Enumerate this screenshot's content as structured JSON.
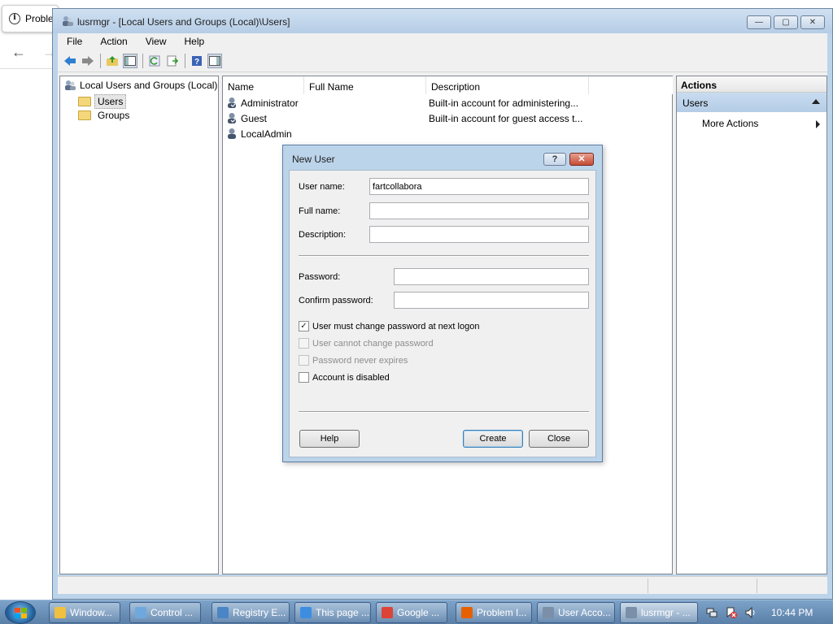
{
  "browser_bg": {
    "tab_label": "Proble"
  },
  "window": {
    "title": "lusrmgr - [Local Users and Groups (Local)\\Users]",
    "min": "—",
    "max": "▢",
    "close": "✕"
  },
  "menu": [
    "File",
    "Action",
    "View",
    "Help"
  ],
  "tree": {
    "root": "Local Users and Groups (Local)",
    "users": "Users",
    "groups": "Groups"
  },
  "list": {
    "columns": [
      "Name",
      "Full Name",
      "Description"
    ],
    "rows": [
      {
        "name": "Administrator",
        "full_name": "",
        "description": "Built-in account for administering..."
      },
      {
        "name": "Guest",
        "full_name": "",
        "description": "Built-in account for guest access t..."
      },
      {
        "name": "LocalAdmin",
        "full_name": "",
        "description": ""
      }
    ]
  },
  "actions": {
    "title": "Actions",
    "section": "Users",
    "more": "More Actions"
  },
  "dialog": {
    "title": "New User",
    "help_glyph": "?",
    "close_glyph": "✕",
    "user_name_label": "User name:",
    "user_name_value": "fartcollabora",
    "full_name_label": "Full name:",
    "full_name_value": "",
    "description_label": "Description:",
    "description_value": "",
    "password_label": "Password:",
    "confirm_label": "Confirm password:",
    "checkboxes": [
      {
        "label": "User must change password at next logon",
        "checked": true,
        "enabled": true,
        "mark": "✓"
      },
      {
        "label": "User cannot change password",
        "checked": false,
        "enabled": false,
        "mark": ""
      },
      {
        "label": "Password never expires",
        "checked": false,
        "enabled": false,
        "mark": ""
      },
      {
        "label": "Account is disabled",
        "checked": false,
        "enabled": true,
        "mark": ""
      }
    ],
    "help_button": "Help",
    "create_button": "Create",
    "close_button": "Close"
  },
  "taskbar": {
    "items": [
      {
        "label": "Window...",
        "color": "#f0c040"
      },
      {
        "label": "Control ...",
        "color": "#6fa8dc"
      },
      {
        "label": "Registry E...",
        "color": "#4a86c5"
      },
      {
        "label": "This page ...",
        "color": "#3d8ee0"
      },
      {
        "label": "Google ...",
        "color": "#db4437"
      },
      {
        "label": "Problem I...",
        "color": "#e66000"
      },
      {
        "label": "User Acco...",
        "color": "#7b8fa8"
      },
      {
        "label": "lusrmgr - ...",
        "color": "#7b8fa8"
      }
    ],
    "clock": "10:44 PM"
  }
}
